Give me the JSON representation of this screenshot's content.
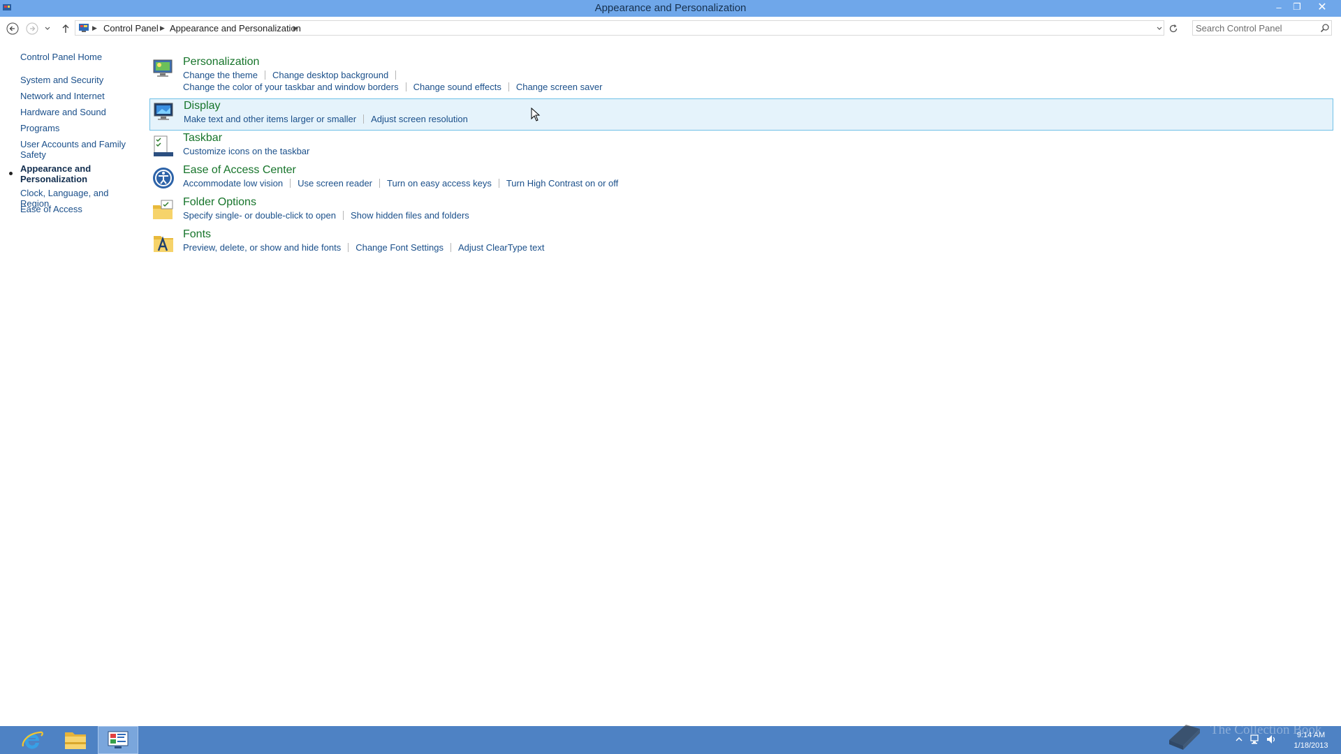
{
  "window": {
    "title": "Appearance and Personalization",
    "controls": {
      "minimize": "–",
      "maximize": "❐",
      "close": "✕"
    }
  },
  "navbar": {
    "breadcrumb": [
      "Control Panel",
      "Appearance and Personalization"
    ],
    "search": {
      "placeholder": "Search Control Panel",
      "value": ""
    }
  },
  "sidebar": {
    "home": "Control Panel Home",
    "items": [
      {
        "label": "System and Security"
      },
      {
        "label": "Network and Internet"
      },
      {
        "label": "Hardware and Sound"
      },
      {
        "label": "Programs"
      },
      {
        "label": "User Accounts and Family Safety"
      },
      {
        "label": "Appearance and Personalization",
        "current": true
      },
      {
        "label": "Clock, Language, and Region"
      },
      {
        "label": "Ease of Access"
      }
    ]
  },
  "categories": [
    {
      "title": "Personalization",
      "icon": "personalization-icon",
      "links": [
        "Change the theme",
        "Change desktop background",
        "Change the color of your taskbar and window borders",
        "Change sound effects",
        "Change screen saver"
      ]
    },
    {
      "title": "Display",
      "icon": "display-icon",
      "highlighted": true,
      "links": [
        "Make text and other items larger or smaller",
        "Adjust screen resolution"
      ]
    },
    {
      "title": "Taskbar",
      "icon": "taskbar-icon",
      "links": [
        "Customize icons on the taskbar"
      ]
    },
    {
      "title": "Ease of Access Center",
      "icon": "ease-of-access-icon",
      "links": [
        "Accommodate low vision",
        "Use screen reader",
        "Turn on easy access keys",
        "Turn High Contrast on or off"
      ]
    },
    {
      "title": "Folder Options",
      "icon": "folder-options-icon",
      "links": [
        "Specify single- or double-click to open",
        "Show hidden files and folders"
      ]
    },
    {
      "title": "Fonts",
      "icon": "fonts-icon",
      "links": [
        "Preview, delete, or show and hide fonts",
        "Change Font Settings",
        "Adjust ClearType text"
      ]
    }
  ],
  "taskbar": {
    "pinned": [
      "internet-explorer-icon",
      "file-explorer-icon",
      "control-panel-icon"
    ],
    "clock": {
      "time": "9:14 AM",
      "date": "1/18/2013"
    },
    "watermark": "The Collection Book"
  },
  "colors": {
    "titlebar": "#6fa7ea",
    "taskbar": "#4e82c4",
    "category_title": "#16742a",
    "link": "#1a4f8a",
    "highlight_bg": "#e5f3fb",
    "highlight_border": "#70c0e7"
  }
}
